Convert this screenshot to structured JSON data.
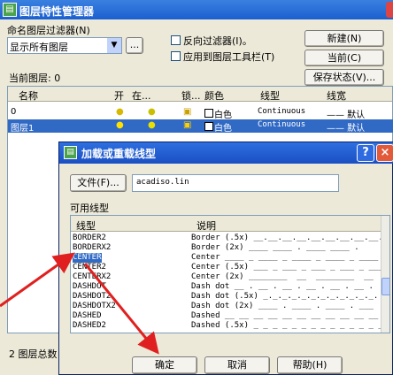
{
  "main_window": {
    "title": "图层特性管理器",
    "filter_group_label": "命名图层过滤器",
    "filter_group_key": "(N)",
    "filter_select_value": "显示所有图层",
    "filter_browse": "...",
    "invert_filter_label": "反向过滤器(I)。",
    "apply_toolbar_label": "应用到图层工具栏(T)",
    "buttons": {
      "new": "新建(N)",
      "current": "当前(C)",
      "save_state": "保存状态(V)..."
    },
    "current_layer_label": "当前图层:",
    "current_layer_value": "0",
    "columns": {
      "name": "名称",
      "on": "开",
      "freeze": "在...",
      "lock": "锁...",
      "color": "颜色",
      "linetype": "线型",
      "lineweight": "线宽"
    },
    "rows": [
      {
        "name": "0",
        "color": "白色",
        "linetype": "Continuous",
        "lineweight": "—— 默认"
      },
      {
        "name": "图层1",
        "color": "白色",
        "linetype": "Continuous",
        "lineweight": "—— 默认"
      }
    ],
    "status_text": "2 图层总数"
  },
  "dialog": {
    "title": "加载或重载线型",
    "file_button": "文件(F)...",
    "file_value": "acadiso.lin",
    "available_label": "可用线型",
    "col_linetype": "线型",
    "col_desc": "说明",
    "linetypes": [
      {
        "name": "BORDER2",
        "desc": "Border (.5x) __.__.__.__.__.__.__.__.__."
      },
      {
        "name": "BORDERX2",
        "desc": "Border (2x) ____ ____ . ____ ____ ."
      },
      {
        "name": "CENTER",
        "desc": "Center ____ _ ____ _ ____ _ ____ _ ____"
      },
      {
        "name": "CENTER2",
        "desc": "Center (.5x) ___ _ ___ _ ___ _ ___ _ ___"
      },
      {
        "name": "CENTERX2",
        "desc": "Center (2x) ________  __  ________  __"
      },
      {
        "name": "DASHDOT",
        "desc": "Dash dot __ . __ . __ . __ . __ . __ ."
      },
      {
        "name": "DASHDOT2",
        "desc": "Dash dot (.5x) _._._._._._._._._._._._."
      },
      {
        "name": "DASHDOTX2",
        "desc": "Dash dot (2x) ____ . ____ . ____ . ___"
      },
      {
        "name": "DASHED",
        "desc": "Dashed __ __ __ __ __ __ __ __ __ __ __"
      },
      {
        "name": "DASHED2",
        "desc": "Dashed (.5x) _ _ _ _ _ _ _ _ _ _ _ _ _ _"
      }
    ],
    "ok": "确定",
    "cancel": "取消",
    "help": "帮助(H)",
    "help_btn": "?",
    "close_btn": "×"
  },
  "colors": {
    "accent": "#316ac5",
    "arrow": "#e02020"
  }
}
